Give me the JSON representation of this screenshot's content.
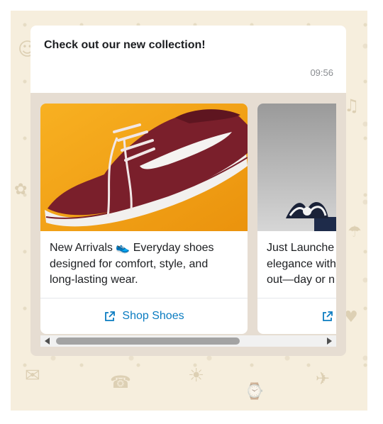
{
  "message": {
    "title": "Check out our new collection!",
    "time": "09:56"
  },
  "cards": [
    {
      "image": "maroon-sneaker-on-orange",
      "body": "New Arrivals 👟 Everyday shoes\ndesigned for comfort, style, and\nlong-lasting wear.",
      "action": {
        "label": "Shop Shoes",
        "icon": "external-link-icon"
      }
    },
    {
      "image": "gift-box-bow-on-gray",
      "body_lines": [
        "Just Launche",
        "elegance with",
        "out—day or n"
      ],
      "action": {
        "label": "",
        "icon": "external-link-icon"
      }
    }
  ],
  "colors": {
    "wallpaper": "#f6eedd",
    "bubble_tray": "#e6ddd2",
    "link": "#0a7cc1",
    "card_1_bg": "#f4a014",
    "sneaker": "#7a1f2b"
  },
  "scrollbar": {
    "position_fraction": 0.0,
    "visible_fraction": 0.68
  }
}
